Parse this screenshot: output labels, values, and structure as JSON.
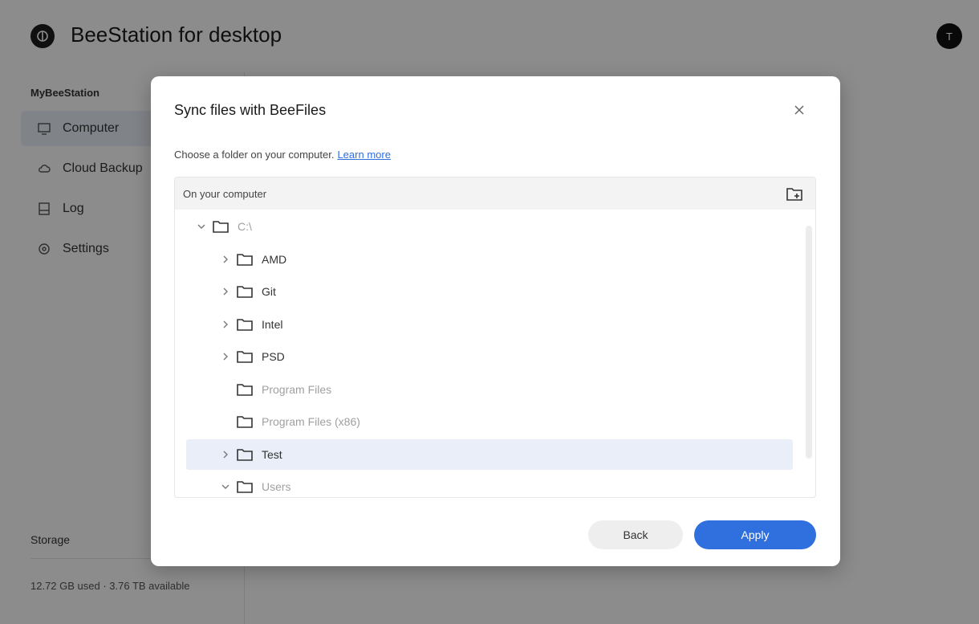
{
  "app": {
    "title": "BeeStation for desktop",
    "user_initial": "T"
  },
  "sidebar": {
    "heading": "MyBeeStation",
    "items": [
      {
        "label": "Computer",
        "icon": "computer-icon",
        "active": true
      },
      {
        "label": "Cloud Backup",
        "icon": "cloud-icon",
        "active": false
      },
      {
        "label": "Log",
        "icon": "log-icon",
        "active": false
      },
      {
        "label": "Settings",
        "icon": "gear-icon",
        "active": false
      }
    ],
    "storage_label": "Storage",
    "storage_info": "12.72 GB used · 3.76 TB available"
  },
  "dialog": {
    "title": "Sync files with BeeFiles",
    "subtitle": "Choose a folder on your computer.",
    "learn_more": "Learn more",
    "picker_label": "On your computer",
    "tree": [
      {
        "name": "C:\\",
        "level": 0,
        "chevron": "expanded",
        "dim": true,
        "selected": false
      },
      {
        "name": "AMD",
        "level": 1,
        "chevron": "collapsed",
        "dim": false,
        "selected": false
      },
      {
        "name": "Git",
        "level": 1,
        "chevron": "collapsed",
        "dim": false,
        "selected": false
      },
      {
        "name": "Intel",
        "level": 1,
        "chevron": "collapsed",
        "dim": false,
        "selected": false
      },
      {
        "name": "PSD",
        "level": 1,
        "chevron": "collapsed",
        "dim": false,
        "selected": false
      },
      {
        "name": "Program Files",
        "level": 1,
        "chevron": "none",
        "dim": true,
        "selected": false
      },
      {
        "name": "Program Files (x86)",
        "level": 1,
        "chevron": "none",
        "dim": true,
        "selected": false
      },
      {
        "name": "Test",
        "level": 1,
        "chevron": "collapsed",
        "dim": false,
        "selected": true
      },
      {
        "name": "Users",
        "level": 1,
        "chevron": "expanded",
        "dim": true,
        "selected": false
      }
    ],
    "back_label": "Back",
    "apply_label": "Apply"
  },
  "colors": {
    "accent": "#2f6fde",
    "selected_row": "#e9eef8",
    "overlay": "rgba(0,0,0,0.45)"
  }
}
